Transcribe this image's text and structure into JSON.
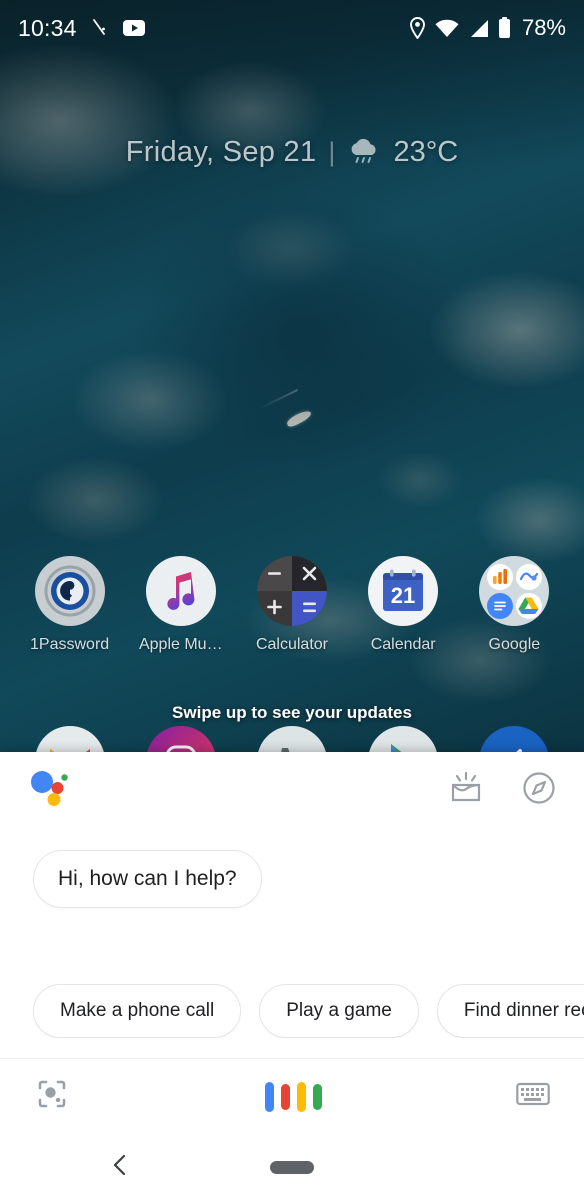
{
  "status_bar": {
    "time": "10:34",
    "battery_percent": "78%",
    "icons": [
      "notification-slash-icon",
      "youtube-icon",
      "location-pin-icon",
      "wifi-icon",
      "cellular-signal-icon",
      "battery-icon"
    ]
  },
  "date_widget": {
    "date": "Friday, Sep 21",
    "separator": "|",
    "temperature": "23°C",
    "weather_icon": "rain-cloud-icon"
  },
  "home_screen": {
    "apps": [
      {
        "label": "1Password",
        "icon": "onepassword-icon"
      },
      {
        "label": "Apple Mu…",
        "icon": "apple-music-icon"
      },
      {
        "label": "Calculator",
        "icon": "calculator-icon"
      },
      {
        "label": "Calendar",
        "icon": "calendar-icon",
        "day": "21"
      },
      {
        "label": "Google",
        "icon": "google-folder-icon"
      }
    ],
    "second_row_icons": [
      "gmail-icon",
      "instagram-icon",
      "phone-icon",
      "play-store-icon",
      "blue-app-icon"
    ],
    "swipe_hint": "Swipe up to see your updates"
  },
  "assistant": {
    "logo": "google-assistant-logo",
    "header_icons": [
      {
        "name": "snapshot-icon"
      },
      {
        "name": "explore-compass-icon"
      }
    ],
    "greeting": "Hi, how can I help?",
    "suggestion_chips": [
      "Make a phone call",
      "Play a game",
      "Find dinner rec"
    ],
    "footer": {
      "lens_icon": "google-lens-icon",
      "mic_indicator": "google-voice-bars",
      "keyboard_icon": "keyboard-icon"
    }
  },
  "nav_bar": {
    "back": "back-chevron-icon",
    "home": "home-pill-icon"
  },
  "colors": {
    "google_blue": "#4285F4",
    "google_red": "#EA4335",
    "google_yellow": "#FBBC05",
    "google_green": "#34A853"
  }
}
